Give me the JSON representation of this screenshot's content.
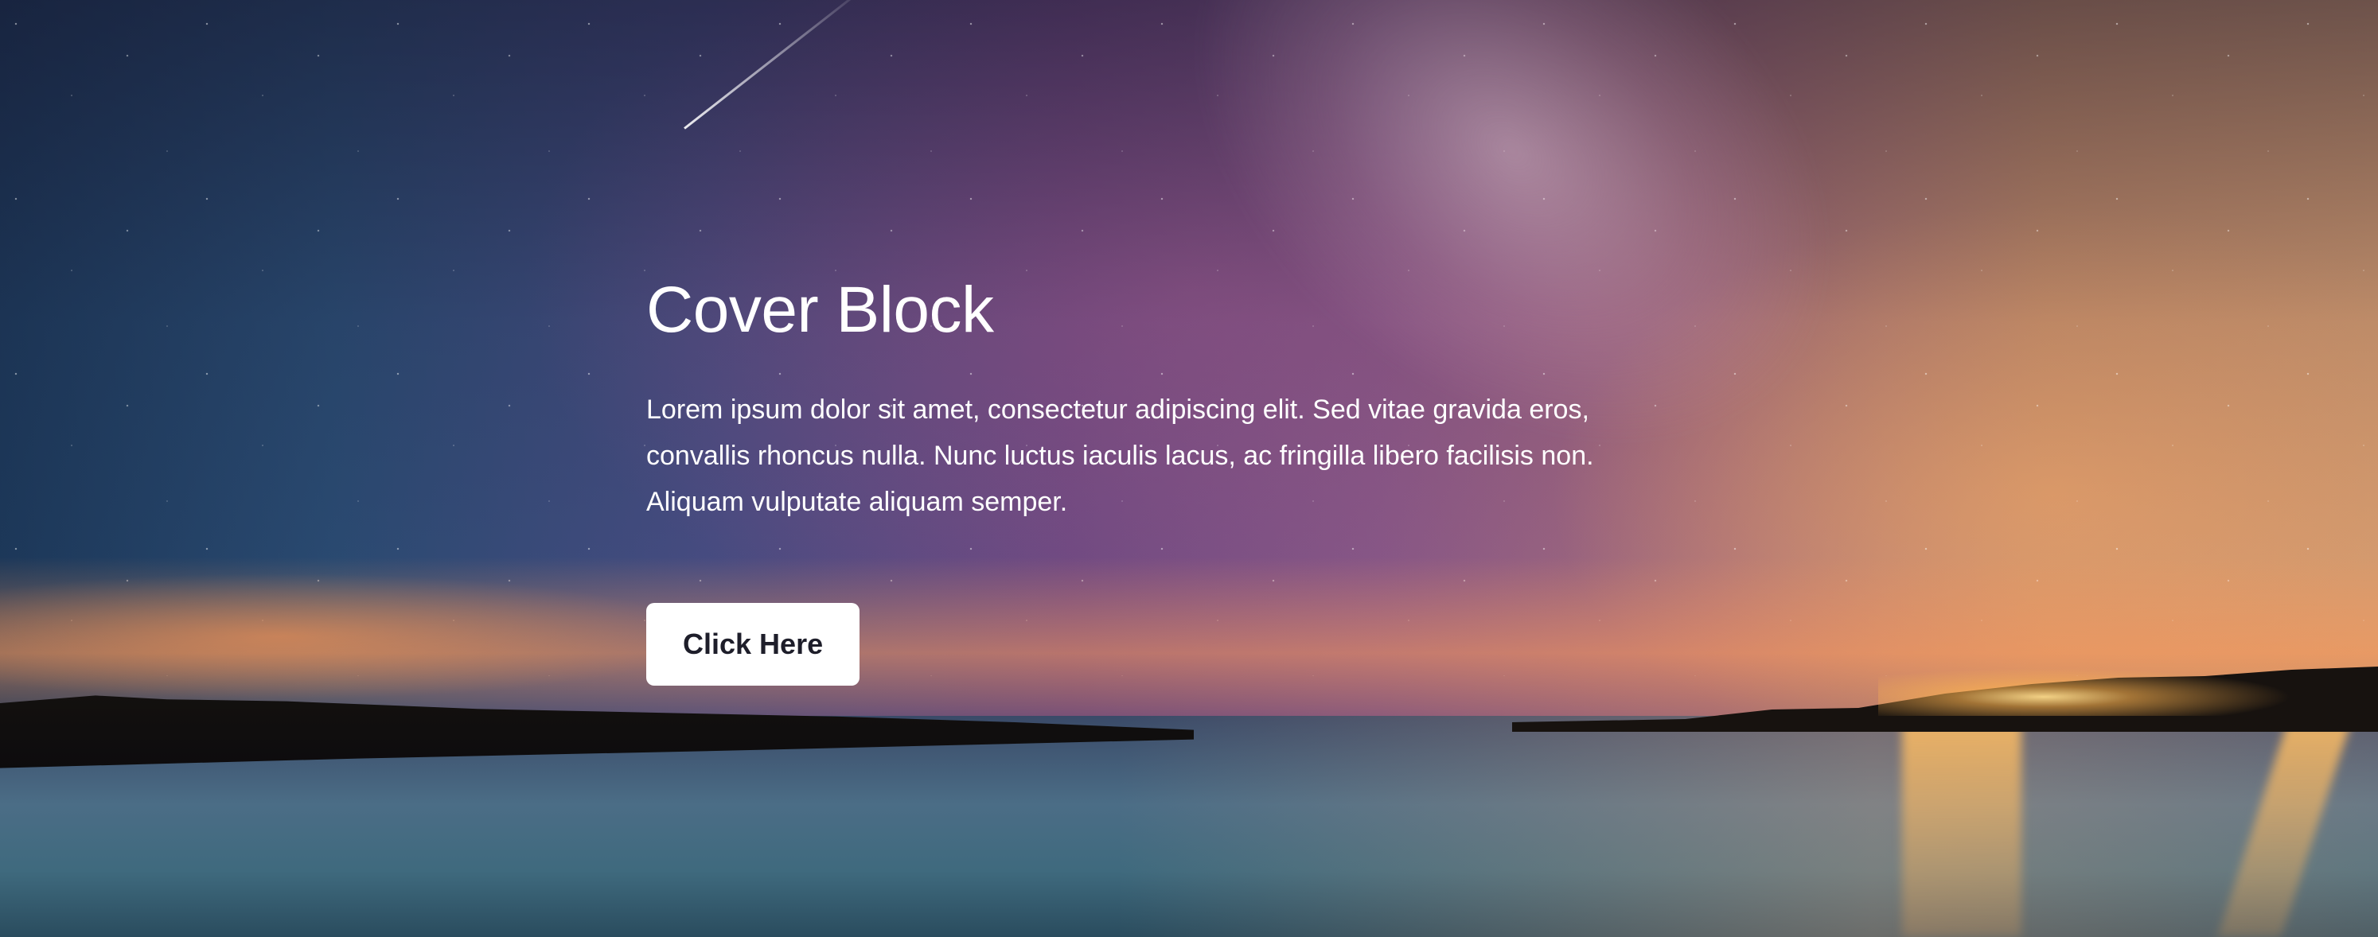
{
  "cover": {
    "title": "Cover Block",
    "description": "Lorem ipsum dolor sit amet, consectetur adipiscing elit. Sed vitae gravida eros, convallis rhoncus nulla. Nunc luctus iaculis lacus, ac fringilla libero facilisis non. Aliquam vulputate aliquam semper.",
    "button_label": "Click Here"
  },
  "colors": {
    "text": "#ffffff",
    "button_bg": "#ffffff",
    "button_text": "#1e1e2a"
  }
}
